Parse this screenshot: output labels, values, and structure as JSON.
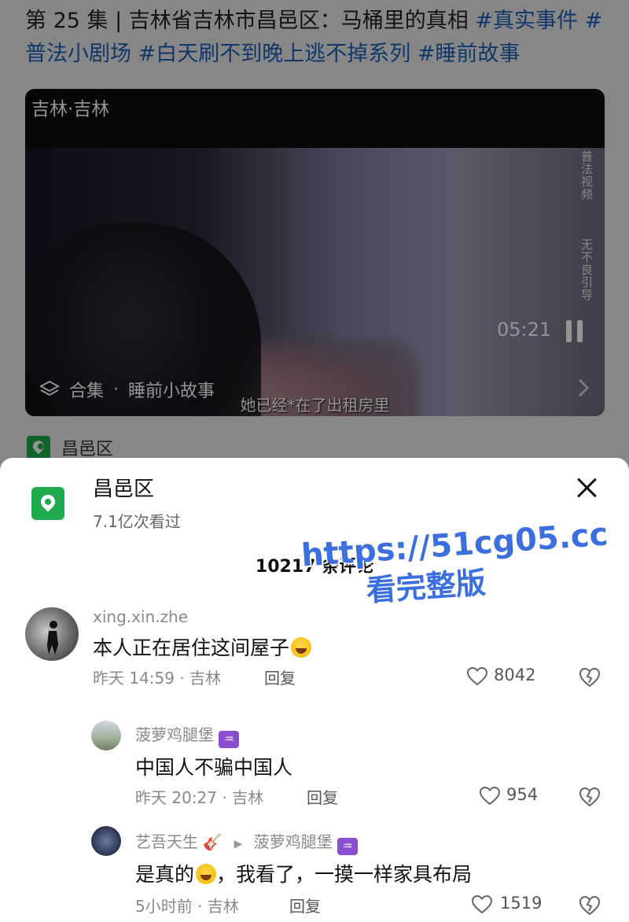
{
  "feed": {
    "caption_prefix": "第 25 集 | 吉林省吉林市昌邑区：马桶里的真相 ",
    "hashtags": [
      "#真实事件",
      "#普法小剧场",
      "#白天刷不到晚上逃不掉系列",
      "#睡前故事"
    ],
    "video": {
      "location": "吉林·吉林",
      "side_text_1": "普法视频",
      "side_text_2": "无不良引导",
      "time": "05:21",
      "collection_label": "合集",
      "collection_dot": "·",
      "collection_name": "睡前小故事",
      "subtitle": "她已经*在了出租房里"
    },
    "location_tag": "昌邑区"
  },
  "sheet": {
    "poi_name": "昌邑区",
    "poi_views": "7.1亿次看过",
    "comment_count": "10217 条评论",
    "watermark_url": "https://51cg05.cc",
    "watermark_sub": "看完整版"
  },
  "comments": [
    {
      "user": "xing.xin.zhe",
      "text": "本人正在居住这间屋子",
      "time_loc": "昨天 14:59 · 吉林",
      "reply": "回复",
      "likes": "8042"
    },
    {
      "user": "菠萝鸡腿堡",
      "text": "中国人不骗中国人",
      "time_loc": "昨天 20:27 · 吉林",
      "reply": "回复",
      "likes": "954"
    },
    {
      "user": "艺吾天生",
      "reply_to": "菠萝鸡腿堡",
      "text_part1": "是真的",
      "text_part2": "，我看了，一摸一样家具布局",
      "time_loc": "5小时前 · 吉林",
      "reply": "回复",
      "likes": "1519"
    }
  ]
}
